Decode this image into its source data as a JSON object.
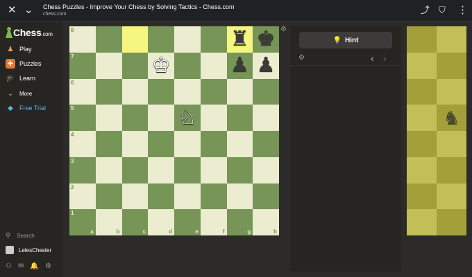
{
  "browser": {
    "page_title": "Chess Puzzles - Improve Your Chess by Solving Tactics - Chess.com",
    "url": "chess.com"
  },
  "sidebar": {
    "logo_text": "Chess",
    "logo_domain": ".com",
    "items": [
      {
        "label": "Play",
        "icon": "play-pawn-icon"
      },
      {
        "label": "Puzzles",
        "icon": "puzzle-icon"
      },
      {
        "label": "Learn",
        "icon": "graduation-cap-icon"
      },
      {
        "label": "More",
        "icon": "chevron-down-icon"
      },
      {
        "label": "Free Trial",
        "icon": "diamond-icon"
      }
    ],
    "search_label": "Search",
    "username": "LelesChester"
  },
  "board": {
    "ranks": [
      "8",
      "7",
      "6",
      "5",
      "4",
      "3",
      "2",
      "1"
    ],
    "files": [
      "a",
      "b",
      "c",
      "d",
      "e",
      "f",
      "g",
      "h"
    ],
    "highlighted_squares": [
      "c8",
      "g8"
    ],
    "pieces": [
      {
        "square": "g8",
        "glyph": "♜",
        "color": "black",
        "name": "black-rook"
      },
      {
        "square": "h8",
        "glyph": "♚",
        "color": "black",
        "name": "black-king"
      },
      {
        "square": "d7",
        "glyph": "♔",
        "color": "white",
        "name": "white-king"
      },
      {
        "square": "g7",
        "glyph": "♟",
        "color": "black",
        "name": "black-pawn"
      },
      {
        "square": "h7",
        "glyph": "♟",
        "color": "black",
        "name": "black-pawn"
      },
      {
        "square": "e5",
        "glyph": "♘",
        "color": "white",
        "name": "white-knight"
      }
    ]
  },
  "panel": {
    "hint_label": "Hint"
  },
  "colors": {
    "light_square": "#ebecd0",
    "dark_square": "#779556",
    "highlight_light": "#f5f682",
    "highlight_dark": "#b9ca43",
    "accent": "#81b64c",
    "free_trial": "#5ab5e8"
  }
}
